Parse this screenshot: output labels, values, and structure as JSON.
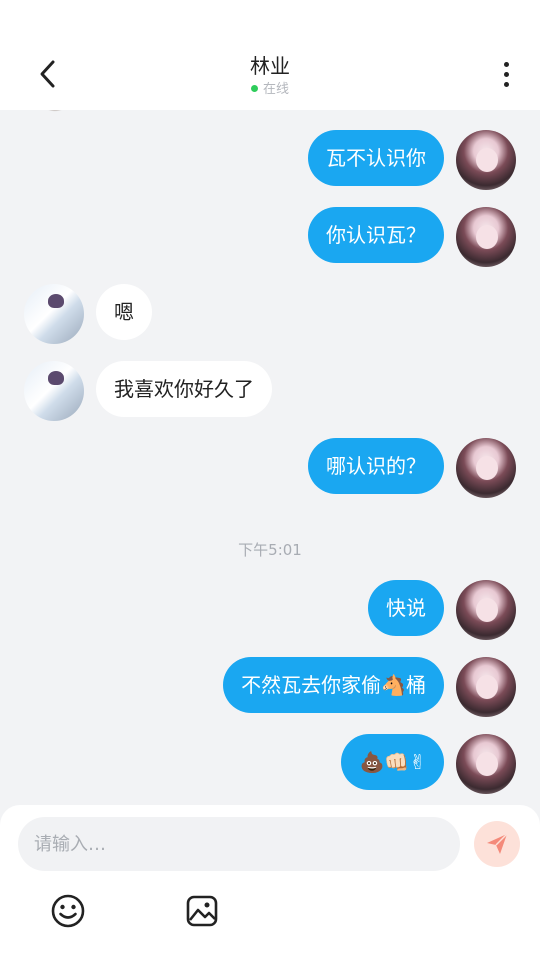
{
  "header": {
    "title": "林业",
    "status": "在线",
    "status_color": "#2ecc5b"
  },
  "messages": [
    {
      "from": "me",
      "text": "瓦不认识你"
    },
    {
      "from": "me",
      "text": "你认识瓦？"
    },
    {
      "from": "other",
      "text": "嗯"
    },
    {
      "from": "other",
      "text": "我喜欢你好久了"
    },
    {
      "from": "me",
      "text": "哪认识的？"
    },
    {
      "type": "timestamp",
      "text": "下午5:01"
    },
    {
      "from": "me",
      "text": "快说"
    },
    {
      "from": "me",
      "text": "不然瓦去你家偷🐴桶"
    },
    {
      "from": "me",
      "text": "💩👊🏻✌"
    }
  ],
  "composer": {
    "placeholder": "请输入…",
    "value": ""
  },
  "colors": {
    "my_bubble": "#1aa7f1",
    "other_bubble": "#ffffff",
    "send_button": "#fde1d9",
    "send_icon": "#f48a7a"
  },
  "icons": {
    "back": "chevron-left-icon",
    "more": "vertical-dots-icon",
    "send": "paper-plane-icon",
    "emoji": "smiley-icon",
    "image": "image-icon"
  }
}
